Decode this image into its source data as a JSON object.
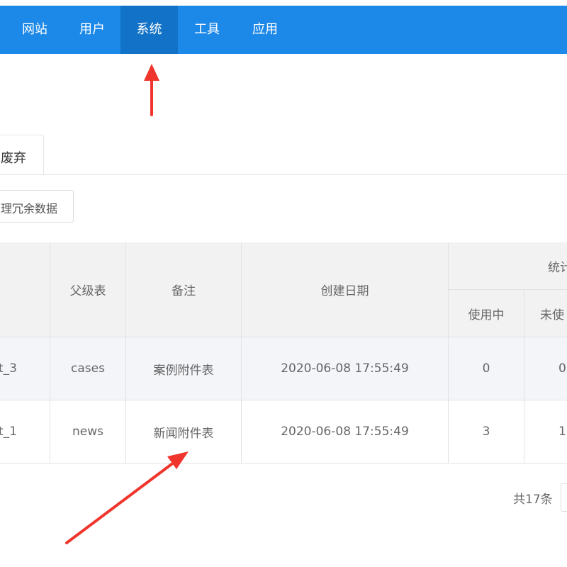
{
  "nav": {
    "items": [
      "网站",
      "用户",
      "系统",
      "工具",
      "应用"
    ],
    "active": "系统"
  },
  "tab": {
    "label": "废弃"
  },
  "toolbar": {
    "clean_label": "理冗余数据"
  },
  "table": {
    "headers": {
      "parent": "父级表",
      "remark": "备注",
      "created": "创建日期",
      "stats": "统计",
      "in_use": "使用中",
      "unused": "未使"
    },
    "rows": [
      {
        "name": "t_3",
        "parent": "cases",
        "remark": "案例附件表",
        "created": "2020-06-08 17:55:49",
        "in_use": "0",
        "unused": "0"
      },
      {
        "name": "t_1",
        "parent": "news",
        "remark": "新闻附件表",
        "created": "2020-06-08 17:55:49",
        "in_use": "3",
        "unused": "1"
      }
    ]
  },
  "pager": {
    "total": "共17条"
  },
  "colors": {
    "nav_bg": "#1c88e8",
    "nav_active": "#1172c7",
    "arrow": "#f0352c"
  }
}
